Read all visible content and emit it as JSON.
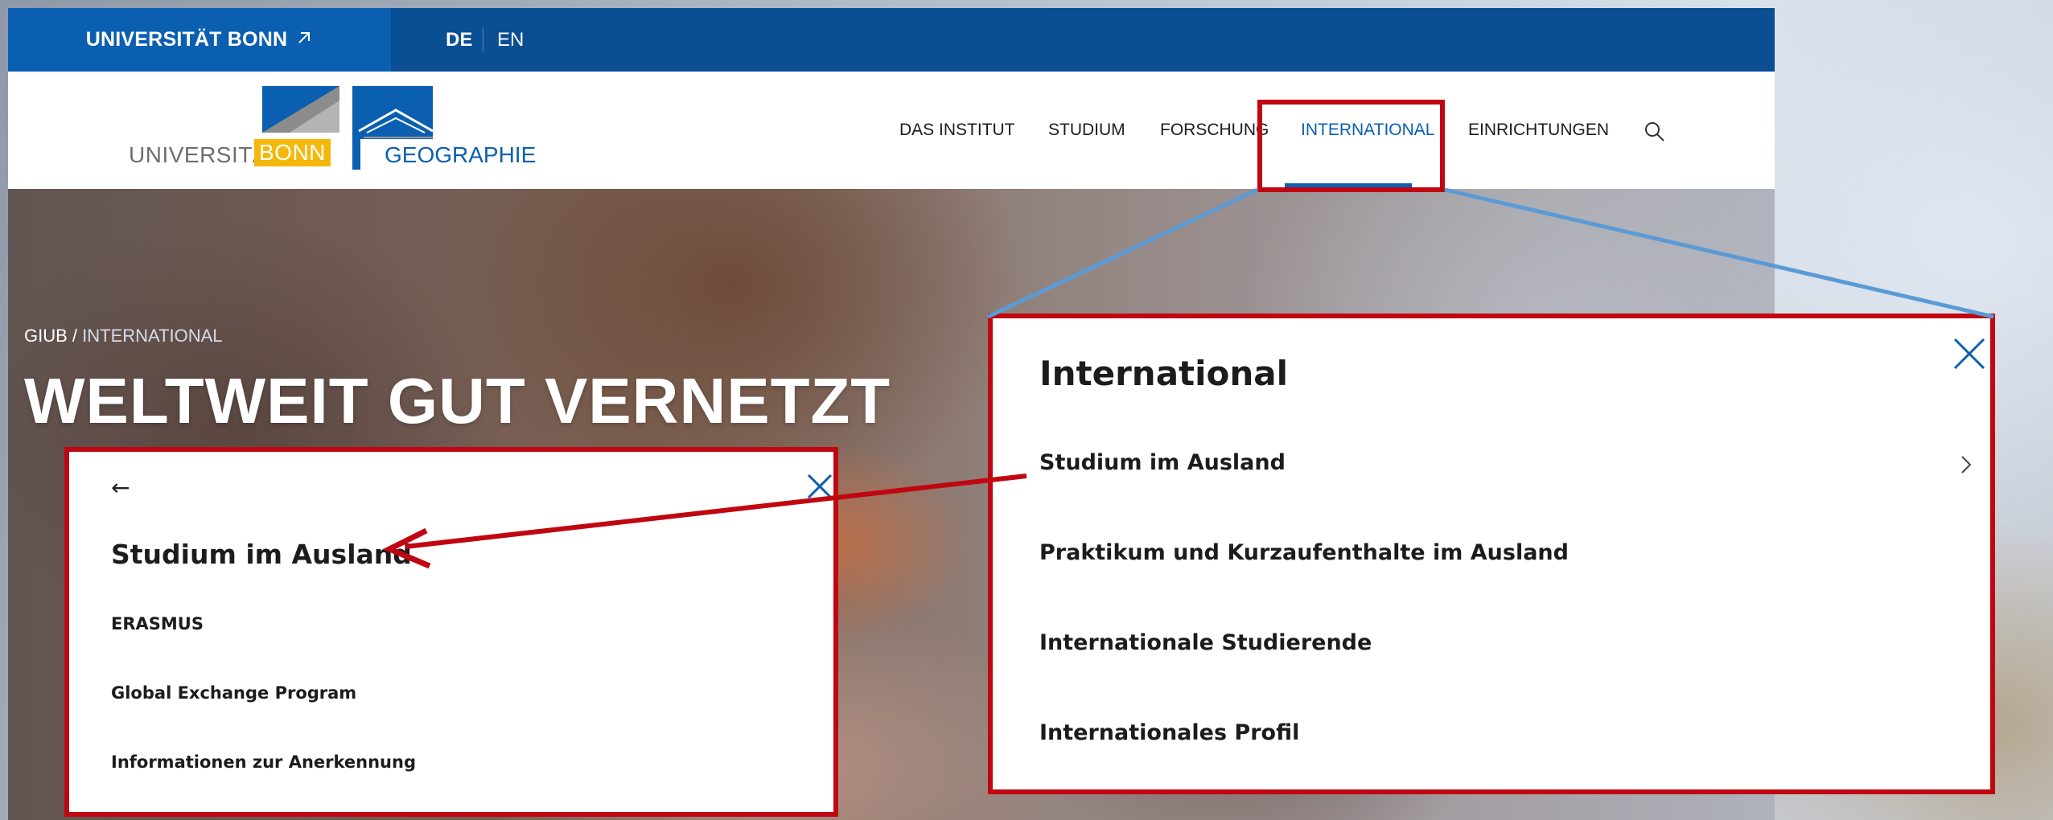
{
  "topbar": {
    "university_link": "UNIVERSITÄT BONN",
    "university_link_icon": "external-arrow-icon",
    "languages": [
      "DE",
      "EN"
    ]
  },
  "logo": {
    "university_text": "UNIVERSITÄT",
    "bonn_text": "BONN",
    "institute_text": "GEOGRAPHIE"
  },
  "nav": {
    "items": [
      {
        "label": "DAS INSTITUT"
      },
      {
        "label": "STUDIUM"
      },
      {
        "label": "FORSCHUNG"
      },
      {
        "label": "INTERNATIONAL",
        "active": true
      },
      {
        "label": "EINRICHTUNGEN"
      }
    ],
    "search_icon": "search-icon"
  },
  "hero": {
    "breadcrumb_root": "GIUB /",
    "breadcrumb_current": "INTERNATIONAL",
    "title": "WELTWEIT GUT VERNETZT"
  },
  "international_panel": {
    "title": "International",
    "items": [
      {
        "label": "Studium im Ausland",
        "has_children": true
      },
      {
        "label": "Praktikum und Kurzaufenthalte im Ausland"
      },
      {
        "label": "Internationale Studierende"
      },
      {
        "label": "Internationales Profil"
      }
    ]
  },
  "submenu_panel": {
    "back_symbol": "←",
    "title": "Studium im Ausland",
    "items": [
      {
        "label": "ERASMUS"
      },
      {
        "label": "Global Exchange Program"
      },
      {
        "label": "Informationen zur Anerkennung"
      }
    ]
  },
  "colors": {
    "brand_blue": "#0b5fb0",
    "topbar_blue": "#0a4e94",
    "highlight_red": "#c00711",
    "callout_blue": "#5b9bd5",
    "bonn_yellow": "#f3b80b"
  }
}
